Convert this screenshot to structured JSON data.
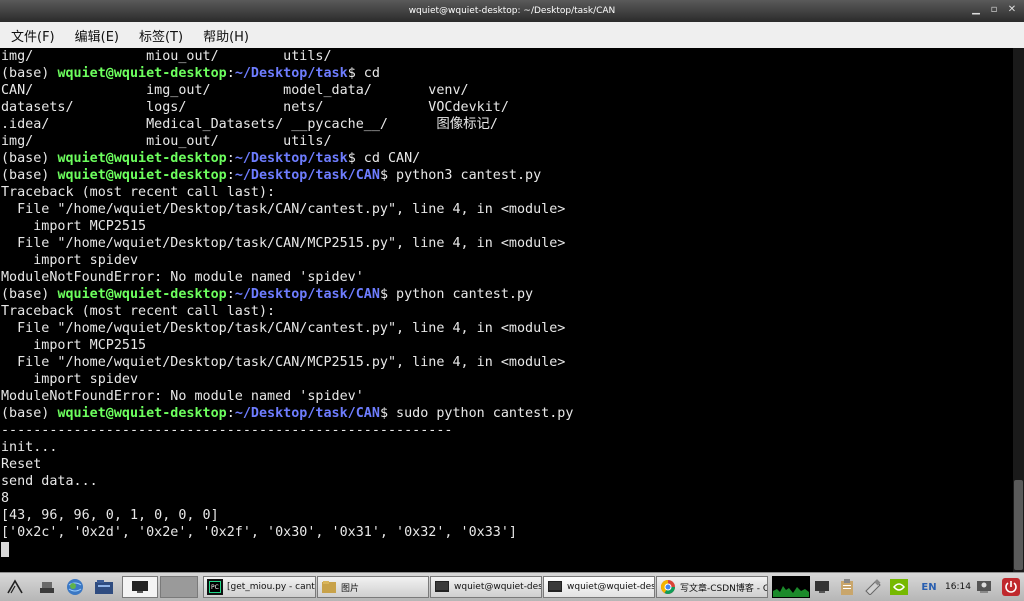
{
  "window": {
    "title": "wquiet@wquiet-desktop: ~/Desktop/task/CAN"
  },
  "menu": {
    "file": "文件(F)",
    "edit": "编辑(E)",
    "tabs": "标签(T)",
    "help": "帮助(H)"
  },
  "terminal": {
    "l0": {
      "text": "img/              miou_out/        utils/"
    },
    "l1": {
      "pre": "(base) ",
      "user": "wquiet@wquiet-desktop",
      "colon": ":",
      "path": "~/Desktop/task",
      "cmd": "$ cd"
    },
    "l2": {
      "text": "CAN/              img_out/         model_data/       venv/"
    },
    "l3": {
      "text": "datasets/         logs/            nets/             VOCdevkit/"
    },
    "l4": {
      "text": ".idea/            Medical_Datasets/ __pycache__/      图像标记/"
    },
    "l5": {
      "text": "img/              miou_out/        utils/"
    },
    "l6": {
      "pre": "(base) ",
      "user": "wquiet@wquiet-desktop",
      "colon": ":",
      "path": "~/Desktop/task",
      "cmd": "$ cd CAN/"
    },
    "l7": {
      "pre": "(base) ",
      "user": "wquiet@wquiet-desktop",
      "colon": ":",
      "path": "~/Desktop/task/CAN",
      "cmd": "$ python3 cantest.py"
    },
    "l8": {
      "text": "Traceback (most recent call last):"
    },
    "l9": {
      "text": "  File \"/home/wquiet/Desktop/task/CAN/cantest.py\", line 4, in <module>"
    },
    "l10": {
      "text": "    import MCP2515"
    },
    "l11": {
      "text": "  File \"/home/wquiet/Desktop/task/CAN/MCP2515.py\", line 4, in <module>"
    },
    "l12": {
      "text": "    import spidev"
    },
    "l13": {
      "text": "ModuleNotFoundError: No module named 'spidev'"
    },
    "l14": {
      "pre": "(base) ",
      "user": "wquiet@wquiet-desktop",
      "colon": ":",
      "path": "~/Desktop/task/CAN",
      "cmd": "$ python cantest.py"
    },
    "l15": {
      "text": "Traceback (most recent call last):"
    },
    "l16": {
      "text": "  File \"/home/wquiet/Desktop/task/CAN/cantest.py\", line 4, in <module>"
    },
    "l17": {
      "text": "    import MCP2515"
    },
    "l18": {
      "text": "  File \"/home/wquiet/Desktop/task/CAN/MCP2515.py\", line 4, in <module>"
    },
    "l19": {
      "text": "    import spidev"
    },
    "l20": {
      "text": "ModuleNotFoundError: No module named 'spidev'"
    },
    "l21": {
      "pre": "(base) ",
      "user": "wquiet@wquiet-desktop",
      "colon": ":",
      "path": "~/Desktop/task/CAN",
      "cmd": "$ sudo python cantest.py"
    },
    "l22": {
      "text": "--------------------------------------------------------"
    },
    "l23": {
      "text": "init..."
    },
    "l24": {
      "text": "Reset"
    },
    "l25": {
      "text": "send data..."
    },
    "l26": {
      "text": "8"
    },
    "l27": {
      "text": "[43, 96, 96, 0, 1, 0, 0, 0]"
    },
    "l28": {
      "text": "['0x2c', '0x2d', '0x2e', '0x2f', '0x30', '0x31', '0x32', '0x33']"
    }
  },
  "taskbar": {
    "tasks": [
      {
        "label": "[get_miou.py - cant..."
      },
      {
        "label": "图片"
      },
      {
        "label": "wquiet@wquiet-des..."
      },
      {
        "label": "wquiet@wquiet-des..."
      },
      {
        "label": "写文章-CSDN博客 - C..."
      }
    ],
    "lang": "EN",
    "clock": "16:14"
  },
  "colors": {
    "prompt_user": "#6dff5e",
    "prompt_path": "#6e7dff",
    "text": "#e8e8e8"
  }
}
